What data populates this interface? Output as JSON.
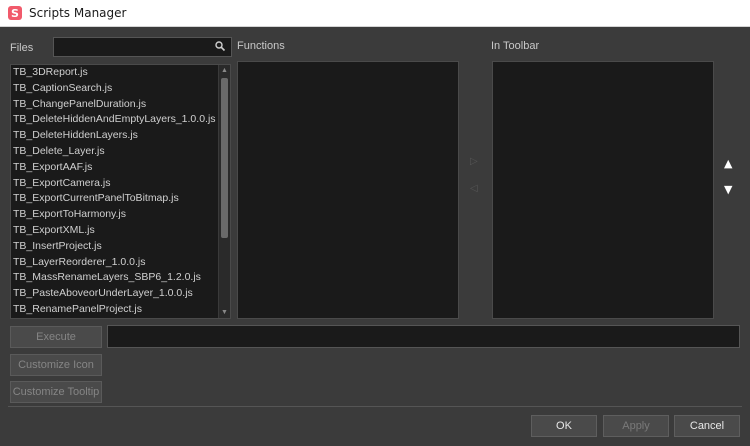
{
  "window": {
    "title": "Scripts Manager",
    "icon": "S"
  },
  "labels": {
    "files": "Files",
    "functions": "Functions",
    "in_toolbar": "In Toolbar"
  },
  "search": {
    "value": "",
    "icon": "search-icon"
  },
  "files": [
    "TB_3DReport.js",
    "TB_CaptionSearch.js",
    "TB_ChangePanelDuration.js",
    "TB_DeleteHiddenAndEmptyLayers_1.0.0.js",
    "TB_DeleteHiddenLayers.js",
    "TB_Delete_Layer.js",
    "TB_ExportAAF.js",
    "TB_ExportCamera.js",
    "TB_ExportCurrentPanelToBitmap.js",
    "TB_ExportToHarmony.js",
    "TB_ExportXML.js",
    "TB_InsertProject.js",
    "TB_LayerReorderer_1.0.0.js",
    "TB_MassRenameLayers_SBP6_1.2.0.js",
    "TB_PasteAboveorUnderLayer_1.0.0.js",
    "TB_RenamePanelProject.js"
  ],
  "transfer": {
    "add": "▷",
    "remove": "◁"
  },
  "order": {
    "up": "▲",
    "down": "▼"
  },
  "actions": {
    "execute": "Execute",
    "customize_icon": "Customize Icon",
    "customize_tooltip": "Customize Tooltip",
    "execute_field": ""
  },
  "dialog": {
    "ok": "OK",
    "apply": "Apply",
    "cancel": "Cancel"
  },
  "colors": {
    "background": "#3b3b3b",
    "panel": "#1a1a1a",
    "button": "#4a4a4a",
    "brand": "#f15a6b"
  }
}
